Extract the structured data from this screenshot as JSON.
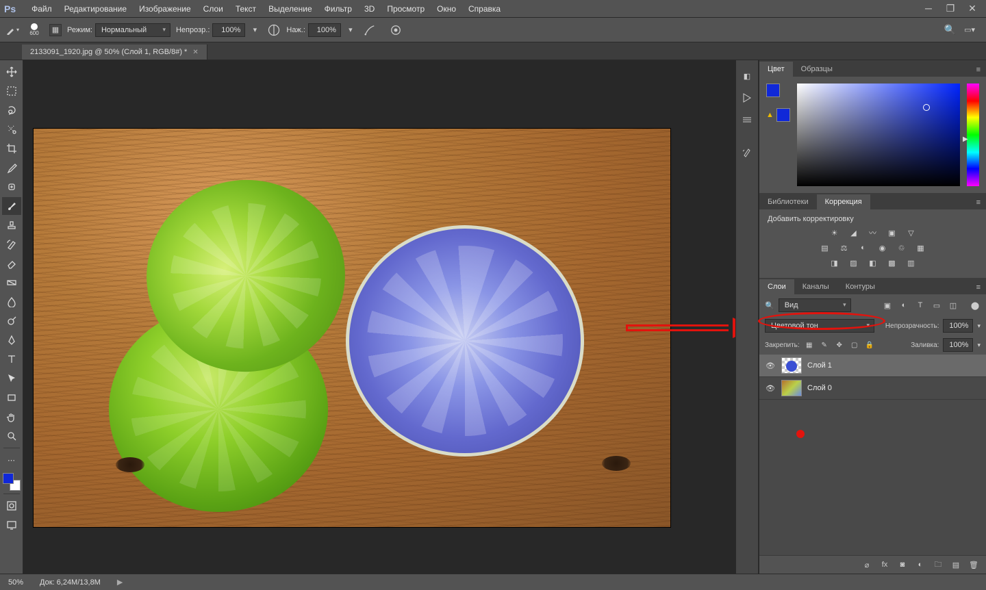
{
  "app_logo": "Ps",
  "menu": [
    "Файл",
    "Редактирование",
    "Изображение",
    "Слои",
    "Текст",
    "Выделение",
    "Фильтр",
    "3D",
    "Просмотр",
    "Окно",
    "Справка"
  ],
  "options_bar": {
    "brush_size": "600",
    "mode_label": "Режим:",
    "blend_mode": "Нормальный",
    "opacity_label": "Непрозр.:",
    "opacity": "100%",
    "flow_label": "Наж.:",
    "flow": "100%"
  },
  "document_tab": {
    "title": "2133091_1920.jpg @ 50% (Слой 1, RGB/8#) *"
  },
  "color_swatches": {
    "fg": "#1028d8",
    "bg": "#ffffff"
  },
  "panels": {
    "color_tabs": [
      "Цвет",
      "Образцы"
    ],
    "libs_tabs": [
      "Библиотеки",
      "Коррекция"
    ],
    "adj_title": "Добавить корректировку",
    "layers_tabs": [
      "Слои",
      "Каналы",
      "Контуры"
    ],
    "layers": {
      "kind": "Вид",
      "blend_label_row": {
        "blend": "Цветовой тон",
        "opacity_label": "Непрозрачность:",
        "opacity": "100%"
      },
      "lock_label": "Закрепить:",
      "fill_label": "Заливка:",
      "fill": "100%",
      "items": [
        {
          "name": "Слой 1",
          "selected": true,
          "thumb": "blue"
        },
        {
          "name": "Слой 0",
          "selected": false,
          "thumb": "limes"
        }
      ]
    }
  },
  "status": {
    "zoom": "50%",
    "doc_info": "Док: 6,24M/13,8M"
  }
}
